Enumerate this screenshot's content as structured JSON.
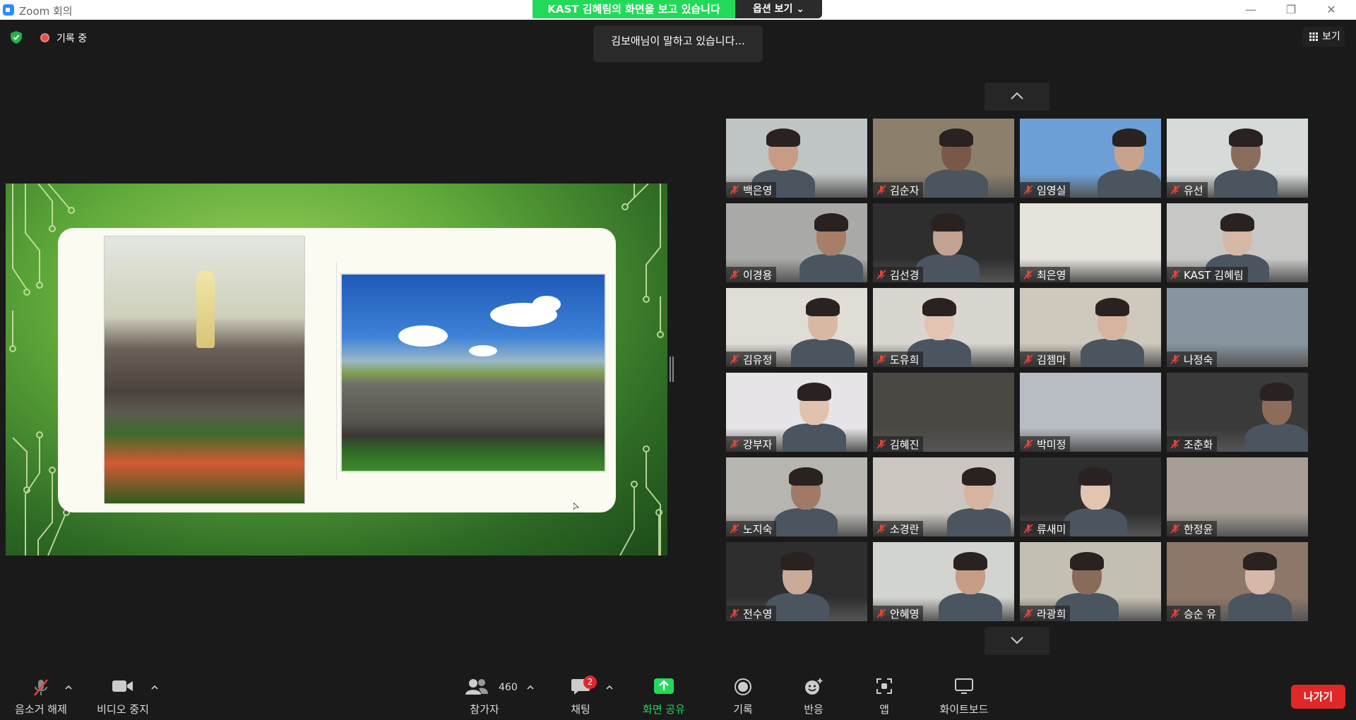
{
  "window": {
    "title": "Zoom 회의",
    "share_banner": "KAST 김혜림의 화면을 보고 있습니다",
    "share_options": "옵션 보기 ⌄",
    "minimize": "—",
    "restore": "❐",
    "close": "✕"
  },
  "overlay": {
    "recording_label": "기록 중",
    "speaking_notice": "김보애님이 말하고 있습니다...",
    "view_label": "보기"
  },
  "gallery": {
    "participants": [
      {
        "name": "백은영",
        "muted": true,
        "bg": "#bfc5c4",
        "skin": "#c89c84"
      },
      {
        "name": "김순자",
        "muted": true,
        "bg": "#8c7f6c",
        "skin": "#7a5848"
      },
      {
        "name": "임영실",
        "muted": true,
        "bg": "#6b9fd6",
        "skin": "#c9a28c"
      },
      {
        "name": "유선",
        "muted": true,
        "bg": "#d6dad8",
        "skin": "#8a6c5c"
      },
      {
        "name": "이경용",
        "muted": true,
        "bg": "#a9aaa7",
        "skin": "#a77e68"
      },
      {
        "name": "김선경",
        "muted": true,
        "bg": "#2e2e2e",
        "skin": "#c2a290"
      },
      {
        "name": "최은영",
        "muted": true,
        "bg": "#e6e3dc",
        "skin": ""
      },
      {
        "name": "KAST 김혜림",
        "muted": true,
        "bg": "#c7c8c6",
        "skin": "#d6b8a6"
      },
      {
        "name": "김유정",
        "muted": true,
        "bg": "#e0ddd6",
        "skin": "#d8b8a2"
      },
      {
        "name": "도유희",
        "muted": true,
        "bg": "#d9d6cf",
        "skin": "#e2c4b2"
      },
      {
        "name": "김젬마",
        "muted": true,
        "bg": "#cfc8bd",
        "skin": "#d7b49d"
      },
      {
        "name": "나정숙",
        "muted": true,
        "bg": "#8895a1",
        "skin": ""
      },
      {
        "name": "강부자",
        "muted": true,
        "bg": "#e6e4e6",
        "skin": "#e0c2ae"
      },
      {
        "name": "김혜진",
        "muted": true,
        "bg": "#4a4842",
        "skin": ""
      },
      {
        "name": "박미정",
        "muted": true,
        "bg": "#b8bcc3",
        "skin": ""
      },
      {
        "name": "조춘화",
        "muted": true,
        "bg": "#3a3a3a",
        "skin": "#8e6c5a"
      },
      {
        "name": "노지숙",
        "muted": true,
        "bg": "#b7b5b0",
        "skin": "#a07a66"
      },
      {
        "name": "소경란",
        "muted": true,
        "bg": "#cbc7c0",
        "skin": "#d6b4a0"
      },
      {
        "name": "류새미",
        "muted": true,
        "bg": "#2e2e2e",
        "skin": "#e2c4b0"
      },
      {
        "name": "한정윤",
        "muted": true,
        "bg": "#a69e95",
        "skin": ""
      },
      {
        "name": "전수영",
        "muted": true,
        "bg": "#2e2e2e",
        "skin": "#c9ab98"
      },
      {
        "name": "안혜영",
        "muted": true,
        "bg": "#d2d4cf",
        "skin": "#c79c84"
      },
      {
        "name": "라광희",
        "muted": true,
        "bg": "#c4bfb3",
        "skin": "#8a6a5a"
      },
      {
        "name": "승순 유",
        "muted": true,
        "bg": "#8d7769",
        "skin": "#d7b8a8"
      }
    ]
  },
  "toolbar": {
    "unmute_label": "음소거 해제",
    "video_label": "비디오 중지",
    "participants_label": "참가자",
    "participants_count": "460",
    "chat_label": "채팅",
    "chat_badge": "2",
    "share_label": "화면 공유",
    "record_label": "기록",
    "reactions_label": "반응",
    "apps_label": "앱",
    "whiteboard_label": "화이트보드",
    "leave_label": "나가기"
  },
  "colors": {
    "accent_green": "#23d959",
    "leave_red": "#e02828",
    "mute_red": "#e0453a"
  }
}
